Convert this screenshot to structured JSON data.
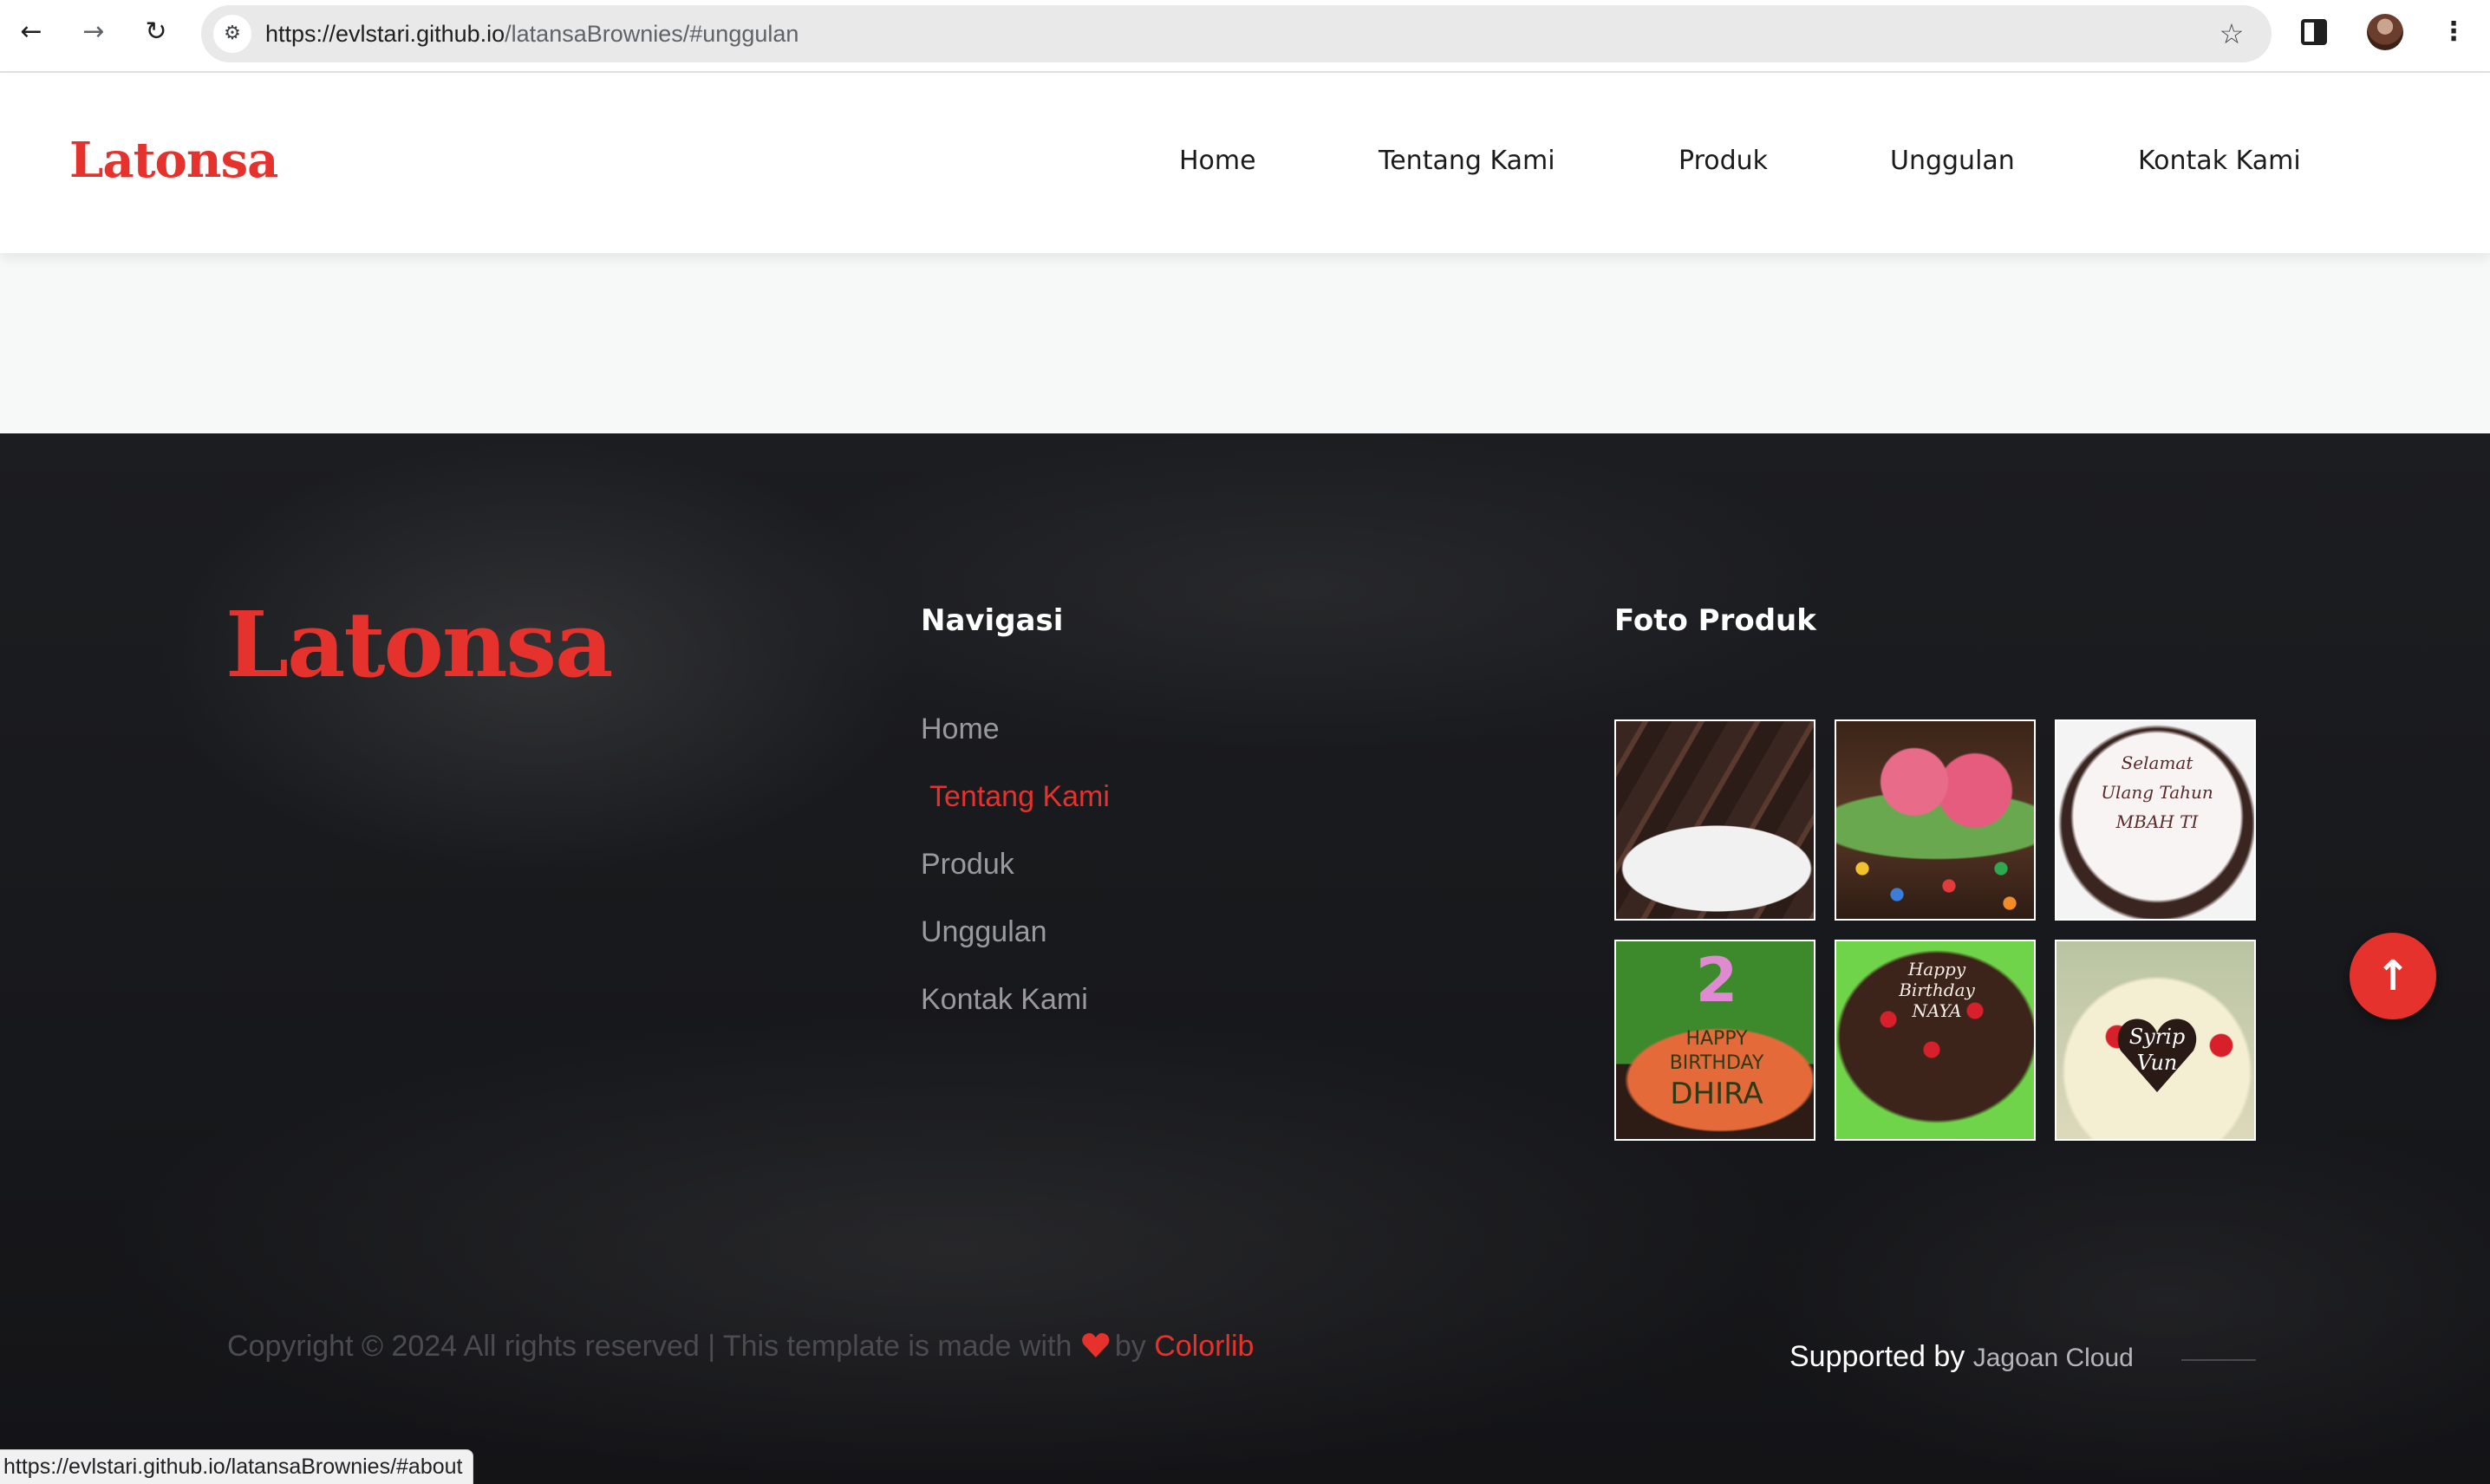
{
  "browser": {
    "url_host": "https://evlstari.github.io",
    "url_path": "/latansaBrownies/#unggulan",
    "back_icon": "arrow-left-icon",
    "forward_icon": "arrow-right-icon",
    "reload_icon": "reload-icon",
    "site_info_icon": "tune-icon",
    "star_icon": "star-icon",
    "menu_icon": "vertical-dots-icon",
    "status_url": "https://evlstari.github.io/latansaBrownies/#about"
  },
  "header": {
    "logo": "Latonsa",
    "nav": [
      "Home",
      "Tentang Kami",
      "Produk",
      "Unggulan",
      "Kontak Kami"
    ]
  },
  "footer": {
    "logo": "Latonsa",
    "nav_title": "Navigasi",
    "nav_links": [
      "Home",
      "Tentang Kami",
      "Produk",
      "Unggulan",
      "Kontak Kami"
    ],
    "active_link": "Tentang Kami",
    "photos_title": "Foto Produk",
    "photo_texts": {
      "photo3": [
        "Selamat",
        "Ulang Tahun",
        "MBAH TI"
      ],
      "photo4": [
        "2",
        "HAPPY",
        "BIRTHDAY",
        "DHIRA"
      ],
      "photo5": [
        "Happy",
        "Birthday",
        "NAYA"
      ],
      "photo6": [
        "Syrip",
        "Vun"
      ]
    },
    "copyright_text": "Copyright © 2024 All rights reserved | This template is made with",
    "copyright_by": "by",
    "copyright_brand": "Colorlib",
    "supported_by": "Supported by",
    "supported_name": "Jagoan Cloud",
    "back_to_top_icon": "arrow-up-icon"
  },
  "colors": {
    "accent": "#e5322d",
    "footer_bg": "#1a1b1e",
    "link_muted": "#9a9a9d"
  }
}
